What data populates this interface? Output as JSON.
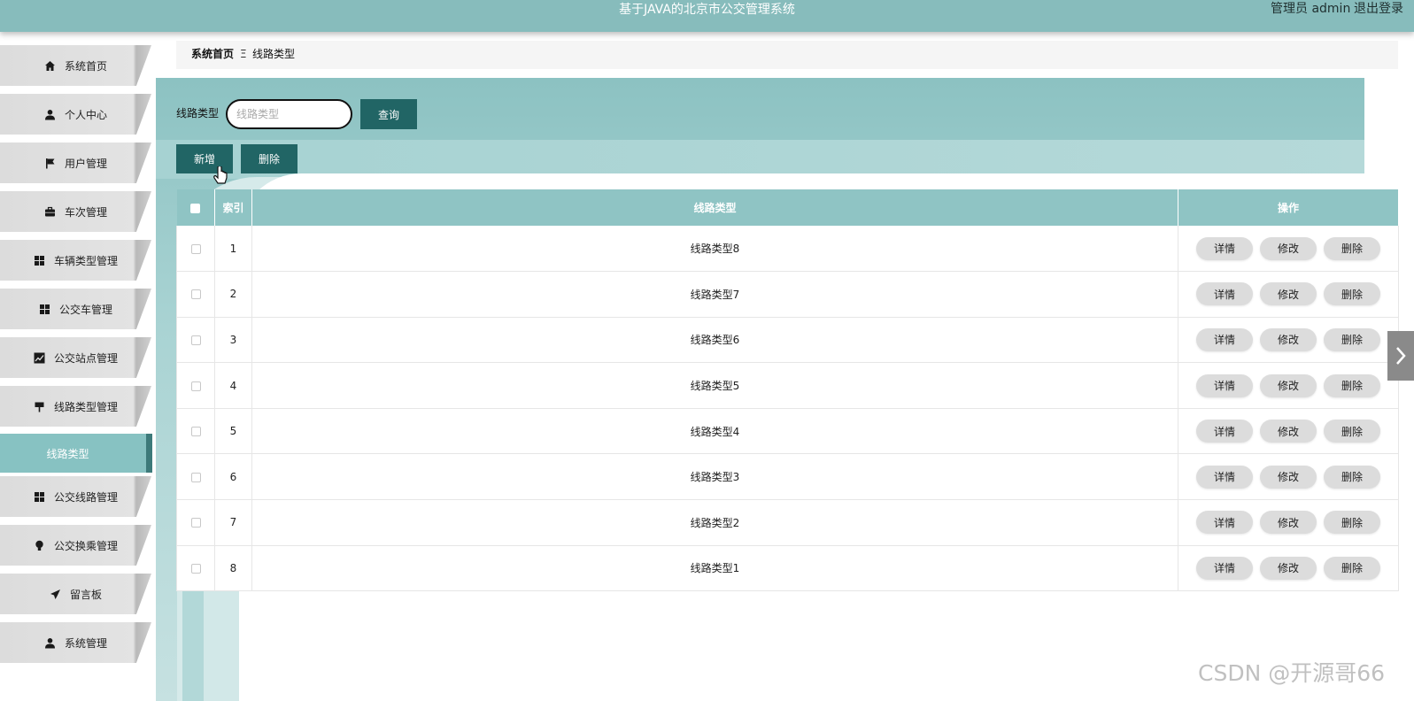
{
  "header": {
    "title": "基于JAVA的北京市公交管理系统",
    "user_label": "管理员 admin",
    "logout": "退出登录",
    "bg_color": "#87bcbc"
  },
  "sidebar": {
    "items": [
      {
        "label": "系统首页",
        "icon": "home-icon"
      },
      {
        "label": "个人中心",
        "icon": "user-icon"
      },
      {
        "label": "用户管理",
        "icon": "flag-icon"
      },
      {
        "label": "车次管理",
        "icon": "briefcase-icon"
      },
      {
        "label": "车辆类型管理",
        "icon": "grid-icon"
      },
      {
        "label": "公交车管理",
        "icon": "grid-icon"
      },
      {
        "label": "公交站点管理",
        "icon": "chart-icon"
      },
      {
        "label": "线路类型管理",
        "icon": "signpost-icon"
      },
      {
        "label": "公交线路管理",
        "icon": "grid-icon"
      },
      {
        "label": "公交换乘管理",
        "icon": "bulb-icon"
      },
      {
        "label": "留言板",
        "icon": "send-icon"
      },
      {
        "label": "系统管理",
        "icon": "user-icon"
      }
    ],
    "active_sub": "线路类型",
    "active_color": "#87c2c2"
  },
  "breadcrumb": {
    "home": "系统首页",
    "separator": "Ξ",
    "current": "线路类型"
  },
  "search": {
    "label": "线路类型",
    "placeholder": "线路类型",
    "value": "",
    "query_button": "查询"
  },
  "actions": {
    "add": "新增",
    "delete": "删除"
  },
  "table": {
    "headers": [
      "索引",
      "线路类型",
      "操作"
    ],
    "rows": [
      {
        "index": "1",
        "type": "线路类型8"
      },
      {
        "index": "2",
        "type": "线路类型7"
      },
      {
        "index": "3",
        "type": "线路类型6"
      },
      {
        "index": "4",
        "type": "线路类型5"
      },
      {
        "index": "5",
        "type": "线路类型4"
      },
      {
        "index": "6",
        "type": "线路类型3"
      },
      {
        "index": "7",
        "type": "线路类型2"
      },
      {
        "index": "8",
        "type": "线路类型1"
      }
    ],
    "row_actions": [
      "详情",
      "修改",
      "删除"
    ]
  },
  "watermark": "CSDN @开源哥66"
}
